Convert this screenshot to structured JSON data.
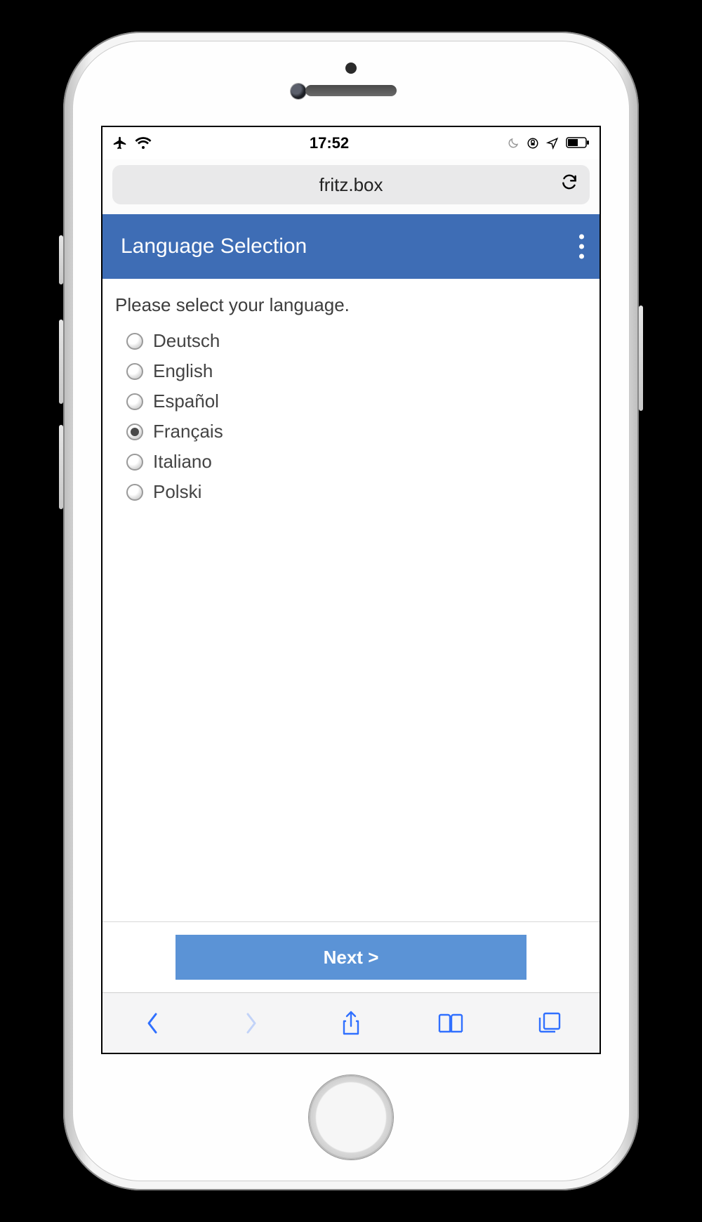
{
  "status_bar": {
    "time": "17:52"
  },
  "url_bar": {
    "domain": "fritz.box"
  },
  "app_header": {
    "title": "Language Selection"
  },
  "content": {
    "prompt": "Please select your language.",
    "options": [
      {
        "label": "Deutsch",
        "selected": false
      },
      {
        "label": "English",
        "selected": false
      },
      {
        "label": "Español",
        "selected": false
      },
      {
        "label": "Français",
        "selected": true
      },
      {
        "label": "Italiano",
        "selected": false
      },
      {
        "label": "Polski",
        "selected": false
      }
    ],
    "next_label": "Next >"
  },
  "colors": {
    "header": "#3e6db5",
    "button": "#5b93d6",
    "ios_blue": "#3070ff"
  }
}
